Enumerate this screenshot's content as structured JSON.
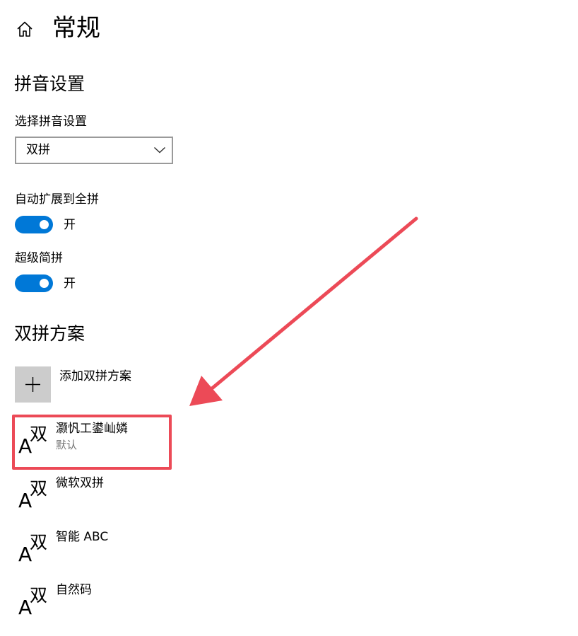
{
  "header": {
    "title": "常规",
    "home_icon": "home-icon"
  },
  "pinyin_settings": {
    "section_title": "拼音设置",
    "select_label": "选择拼音设置",
    "select_value": "双拼",
    "toggles": [
      {
        "label": "自动扩展到全拼",
        "state": "开",
        "on": true
      },
      {
        "label": "超级简拼",
        "state": "开",
        "on": true
      }
    ]
  },
  "schemes": {
    "section_title": "双拼方案",
    "add_label": "添加双拼方案",
    "items": [
      {
        "name": "灏忛工鍙屾嫾",
        "subtitle": "默认",
        "icon_a": "A",
        "icon_han": "双"
      },
      {
        "name": "微软双拼",
        "icon_a": "A",
        "icon_han": "双"
      },
      {
        "name": "智能 ABC",
        "icon_a": "A",
        "icon_han": "双"
      },
      {
        "name": "自然码",
        "icon_a": "A",
        "icon_han": "双"
      }
    ]
  },
  "colors": {
    "accent": "#0078d7",
    "annotation": "#ec4a57",
    "tile_gray": "#cccccc",
    "secondary_text": "#767676"
  }
}
